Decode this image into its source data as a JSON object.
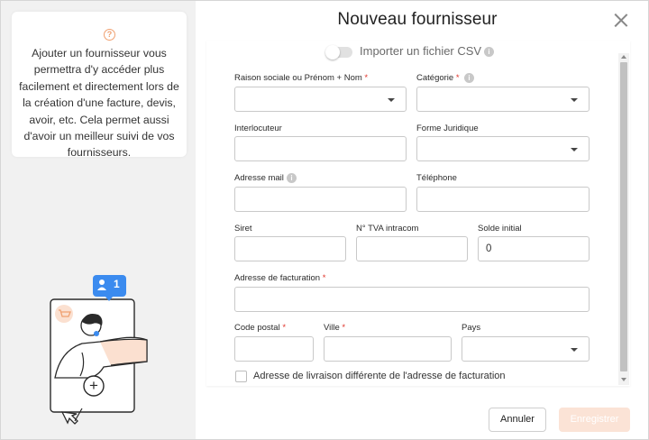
{
  "modal": {
    "title": "Nouveau fournisseur",
    "close_icon": "close-icon"
  },
  "left_panel": {
    "help_icon": "?",
    "info_text": "Ajouter un fournisseur vous permettra d'y accéder plus facilement et directement lors de la création d'une facture, devis, avoir, etc. Cela permet aussi d'avoir un meilleur suivi de vos fournisseurs.",
    "illustration": {
      "badge_count": "1",
      "plus": "+"
    }
  },
  "import": {
    "label": "Importer un fichier CSV",
    "enabled": false,
    "info": "i"
  },
  "form": {
    "raison_sociale": {
      "label": "Raison sociale ou Prénom + Nom",
      "required": "*",
      "value": ""
    },
    "categorie": {
      "label": "Catégorie",
      "required": "*",
      "info": "i",
      "value": ""
    },
    "interlocuteur": {
      "label": "Interlocuteur",
      "value": ""
    },
    "forme_juridique": {
      "label": "Forme Juridique",
      "value": ""
    },
    "adresse_mail": {
      "label": "Adresse mail",
      "info": "i",
      "value": ""
    },
    "telephone": {
      "label": "Téléphone",
      "value": ""
    },
    "siret": {
      "label": "Siret",
      "value": ""
    },
    "tva": {
      "label": "N° TVA intracom",
      "value": ""
    },
    "solde_initial": {
      "label": "Solde initial",
      "value": "0"
    },
    "adresse_facturation": {
      "label": "Adresse de facturation",
      "required": "*",
      "value": ""
    },
    "code_postal": {
      "label": "Code postal",
      "required": "*",
      "value": ""
    },
    "ville": {
      "label": "Ville",
      "required": "*",
      "value": ""
    },
    "pays": {
      "label": "Pays",
      "value": ""
    },
    "livraison_checkbox": {
      "label": "Adresse de livraison différente de l'adresse de facturation",
      "checked": false
    }
  },
  "buttons": {
    "cancel": "Annuler",
    "save": "Enregistrer"
  },
  "colors": {
    "accent": "#f0a070",
    "required": "#e0352b",
    "save_disabled_bg": "#fbe3d6",
    "badge_blue": "#3b8bef"
  }
}
